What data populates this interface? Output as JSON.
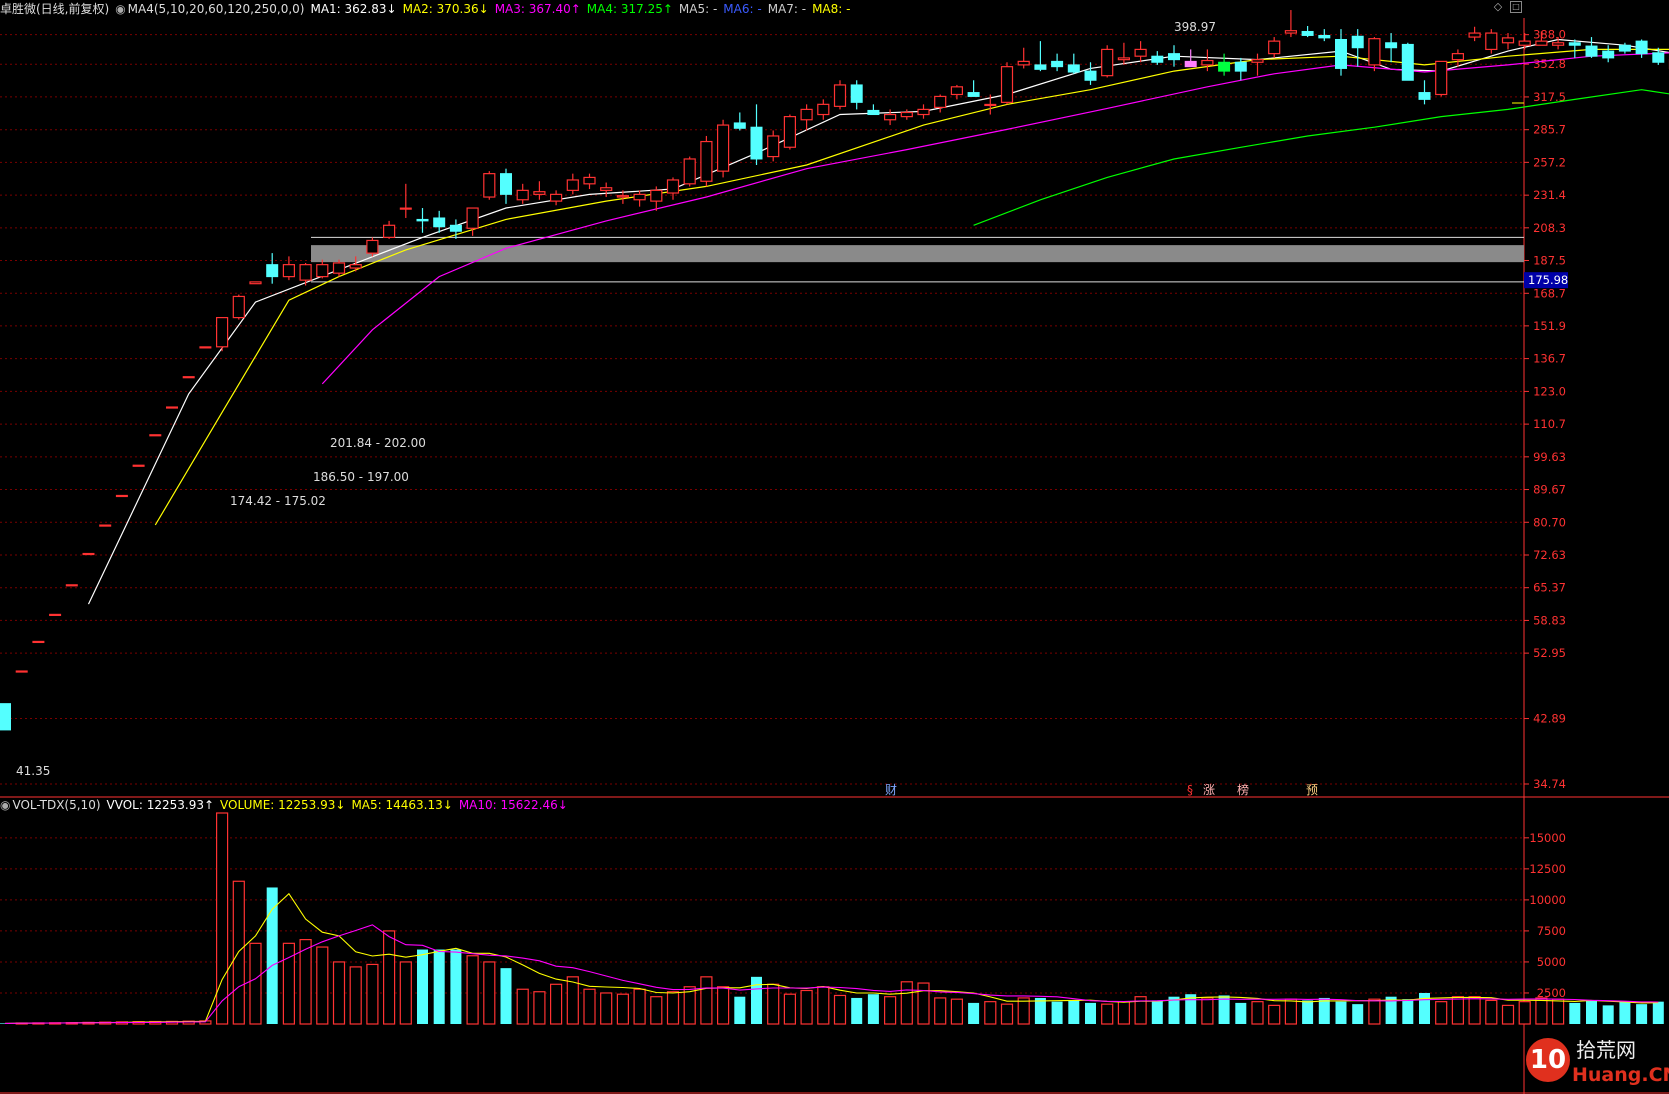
{
  "header": {
    "title": "卓胜微(日线,前复权)",
    "ma_params": "MA4(5,10,20,60,120,250,0,0)",
    "ma": [
      {
        "label": "MA1: 362.83↓",
        "color": "#ffffff"
      },
      {
        "label": "MA2: 370.36↓",
        "color": "#ffff00"
      },
      {
        "label": "MA3: 367.40↑",
        "color": "#ff00ff"
      },
      {
        "label": "MA4: 317.25↑",
        "color": "#00ff00"
      },
      {
        "label": "MA5: -",
        "color": "#cccccc"
      },
      {
        "label": "MA6: -",
        "color": "#3b5bff"
      },
      {
        "label": "MA7: -",
        "color": "#cccccc"
      },
      {
        "label": "MA8: -",
        "color": "#ffff00"
      }
    ]
  },
  "vol_header": {
    "name": "VOL-TDX(5,10)",
    "vvol": "VVOL: 12253.93↑",
    "volume": "VOLUME: 12253.93↓",
    "ma5": "MA5: 14463.13↓",
    "ma10": "MA10: 15622.46↓"
  },
  "annotations": {
    "high": "398.97",
    "low": "41.35",
    "range1": "201.84 - 202.00",
    "range2": "186.50 - 197.00",
    "range3": "174.42 - 175.02",
    "current_price": "175.98",
    "events": [
      "财",
      "§",
      "涨",
      "榜",
      "预"
    ]
  },
  "watermark": {
    "num": "10",
    "cn": "拾荒网",
    "en": "Huang.CN"
  },
  "colors": {
    "up": "#ff3232",
    "down": "#54ffff",
    "grid": "#7a0000",
    "axis": "#ff3232",
    "ma1": "#ffffff",
    "ma2": "#ffff00",
    "ma3": "#ff00ff",
    "ma4": "#00ff00"
  },
  "chart_data": [
    {
      "type": "candlestick",
      "title": "卓胜微(日线,前复权)",
      "y_ticks": [
        "388.0",
        "352.8",
        "317.5",
        "285.7",
        "257.2",
        "231.4",
        "208.3",
        "187.5",
        "168.7",
        "151.9",
        "136.7",
        "123.0",
        "110.7",
        "99.63",
        "89.67",
        "80.70",
        "72.63",
        "65.37",
        "58.83",
        "52.95",
        "42.89",
        "34.74"
      ],
      "y_scale": "log",
      "ylim": [
        34.74,
        398.97
      ],
      "candles": [
        [
          45,
          45,
          41.35,
          41.35
        ],
        [
          50,
          50,
          50,
          50
        ],
        [
          55,
          55,
          55,
          55
        ],
        [
          60,
          60,
          60,
          60
        ],
        [
          66,
          66,
          66,
          66
        ],
        [
          73,
          73,
          73,
          73
        ],
        [
          80,
          80,
          80,
          80
        ],
        [
          88,
          88,
          88,
          88
        ],
        [
          97,
          97,
          97,
          97
        ],
        [
          107,
          107,
          107,
          107
        ],
        [
          117,
          117,
          117,
          117
        ],
        [
          129,
          129,
          129,
          129
        ],
        [
          142,
          142,
          142,
          142
        ],
        [
          142,
          156,
          140,
          156
        ],
        [
          156,
          168,
          155,
          167
        ],
        [
          174,
          175.02,
          174.42,
          175
        ],
        [
          185,
          192,
          174,
          178
        ],
        [
          178,
          190,
          176,
          185
        ],
        [
          176,
          186,
          173,
          185
        ],
        [
          178,
          188,
          177,
          185
        ],
        [
          180,
          188,
          178,
          186
        ],
        [
          183,
          190,
          181,
          185
        ],
        [
          192,
          202,
          190,
          200
        ],
        [
          202,
          213,
          201,
          210
        ],
        [
          222,
          240,
          215,
          222
        ],
        [
          214,
          222,
          205,
          213
        ],
        [
          215,
          220,
          205,
          209
        ],
        [
          210,
          214,
          201,
          206
        ],
        [
          208,
          222,
          203,
          222
        ],
        [
          230,
          250,
          228,
          248
        ],
        [
          248,
          252,
          225,
          232
        ],
        [
          228,
          240,
          225,
          235
        ],
        [
          232,
          242,
          228,
          234
        ],
        [
          227,
          235,
          224,
          232
        ],
        [
          235,
          248,
          232,
          243
        ],
        [
          240,
          248,
          236,
          245
        ],
        [
          235,
          241,
          230,
          237
        ],
        [
          230,
          235,
          225,
          231
        ],
        [
          228,
          235,
          223,
          232
        ],
        [
          227,
          238,
          220,
          235
        ],
        [
          233,
          245,
          228,
          243
        ],
        [
          240,
          262,
          238,
          260
        ],
        [
          242,
          280,
          238,
          275
        ],
        [
          250,
          295,
          245,
          290
        ],
        [
          292,
          302,
          285,
          287
        ],
        [
          288,
          310,
          255,
          260
        ],
        [
          262,
          285,
          258,
          280
        ],
        [
          270,
          300,
          268,
          298
        ],
        [
          295,
          310,
          285,
          305
        ],
        [
          300,
          315,
          295,
          310
        ],
        [
          308,
          335,
          305,
          330
        ],
        [
          330,
          335,
          305,
          312
        ],
        [
          304,
          310,
          300,
          300
        ],
        [
          295,
          305,
          290,
          300
        ],
        [
          298,
          305,
          295,
          302
        ],
        [
          300,
          310,
          296,
          305
        ],
        [
          307,
          320,
          302,
          318
        ],
        [
          320,
          330,
          315,
          328
        ],
        [
          322,
          335,
          318,
          318
        ],
        [
          310,
          320,
          300,
          310
        ],
        [
          312,
          355,
          310,
          350
        ],
        [
          352,
          372,
          348,
          356
        ],
        [
          352,
          380,
          345,
          347
        ],
        [
          356,
          365,
          345,
          350
        ],
        [
          352,
          365,
          342,
          344
        ],
        [
          345,
          355,
          330,
          335
        ],
        [
          340,
          375,
          338,
          370
        ],
        [
          358,
          378,
          352,
          360
        ],
        [
          362,
          380,
          355,
          370
        ],
        [
          362,
          368,
          352,
          355
        ],
        [
          365,
          375,
          350,
          358
        ],
        [
          356,
          370,
          350,
          350
        ],
        [
          352,
          370,
          345,
          357
        ],
        [
          355,
          365,
          340,
          345
        ],
        [
          355,
          360,
          335,
          345
        ],
        [
          355,
          365,
          340,
          358
        ],
        [
          365,
          385,
          360,
          380
        ],
        [
          390,
          420,
          385,
          393
        ],
        [
          392,
          398.97,
          385,
          387
        ],
        [
          387,
          395,
          380,
          384
        ],
        [
          382,
          395,
          340,
          348
        ],
        [
          386,
          395,
          350,
          372
        ],
        [
          352,
          385,
          345,
          383
        ],
        [
          378,
          390,
          355,
          372
        ],
        [
          376,
          378,
          345,
          335
        ],
        [
          322,
          335,
          310,
          315
        ],
        [
          320,
          355,
          318,
          356
        ],
        [
          358,
          370,
          350,
          365
        ],
        [
          385,
          398,
          380,
          390
        ],
        [
          370,
          395,
          365,
          390
        ],
        [
          378,
          390,
          370,
          384
        ],
        [
          375,
          390,
          370,
          380
        ],
        [
          375,
          392,
          375,
          380
        ],
        [
          375,
          385,
          370,
          378
        ],
        [
          378,
          382,
          360,
          375
        ],
        [
          374,
          385,
          360,
          362
        ],
        [
          368,
          375,
          355,
          360
        ],
        [
          375,
          378,
          365,
          368
        ],
        [
          380,
          382,
          360,
          365
        ],
        [
          366,
          372,
          352,
          355
        ],
        [
          348,
          360,
          350,
          358
        ]
      ],
      "ma_lines": {
        "MA1": [
          [
            5,
            62
          ],
          [
            11,
            122
          ],
          [
            15,
            164
          ],
          [
            20,
            182
          ],
          [
            25,
            202
          ],
          [
            30,
            222
          ],
          [
            35,
            232
          ],
          [
            40,
            236
          ],
          [
            45,
            265
          ],
          [
            50,
            300
          ],
          [
            55,
            303
          ],
          [
            60,
            320
          ],
          [
            65,
            348
          ],
          [
            70,
            362
          ],
          [
            75,
            358
          ],
          [
            80,
            368
          ],
          [
            83,
            347
          ],
          [
            86,
            345
          ],
          [
            90,
            368
          ],
          [
            93,
            382
          ],
          [
            97,
            375
          ],
          [
            101,
            362
          ]
        ],
        "MA2": [
          [
            9,
            80
          ],
          [
            13,
            115
          ],
          [
            17,
            165
          ],
          [
            20,
            178
          ],
          [
            24,
            194
          ],
          [
            30,
            214
          ],
          [
            36,
            227
          ],
          [
            42,
            238
          ],
          [
            48,
            255
          ],
          [
            55,
            290
          ],
          [
            60,
            310
          ],
          [
            65,
            325
          ],
          [
            70,
            345
          ],
          [
            75,
            358
          ],
          [
            80,
            362
          ],
          [
            85,
            352
          ],
          [
            90,
            362
          ],
          [
            95,
            370
          ],
          [
            101,
            370
          ]
        ],
        "MA3": [
          [
            19,
            126
          ],
          [
            22,
            150
          ],
          [
            26,
            178
          ],
          [
            30,
            195
          ],
          [
            36,
            213
          ],
          [
            42,
            230
          ],
          [
            48,
            252
          ],
          [
            54,
            268
          ],
          [
            60,
            286
          ],
          [
            66,
            306
          ],
          [
            72,
            328
          ],
          [
            76,
            342
          ],
          [
            80,
            352
          ],
          [
            85,
            344
          ],
          [
            90,
            352
          ],
          [
            95,
            362
          ],
          [
            101,
            367
          ]
        ],
        "MA4": [
          [
            58,
            210
          ],
          [
            62,
            228
          ],
          [
            66,
            245
          ],
          [
            70,
            260
          ],
          [
            74,
            270
          ],
          [
            78,
            280
          ],
          [
            82,
            288
          ],
          [
            86,
            298
          ],
          [
            90,
            305
          ],
          [
            94,
            315
          ],
          [
            98,
            325
          ],
          [
            101,
            317.25
          ]
        ]
      }
    },
    {
      "type": "bar",
      "title": "VOL-TDX(5,10)",
      "y_ticks": [
        "15000",
        "12500",
        "10000",
        "7500",
        "5000",
        "2500"
      ],
      "ylim": [
        0,
        17000
      ],
      "volumes": [
        50,
        80,
        90,
        100,
        110,
        130,
        150,
        170,
        190,
        200,
        210,
        230,
        250,
        17000,
        11500,
        6500,
        11000,
        6500,
        6800,
        6200,
        5000,
        4600,
        4800,
        7500,
        5000,
        6000,
        6000,
        6000,
        5500,
        5000,
        4500,
        2800,
        2600,
        3200,
        3800,
        2800,
        2500,
        2400,
        2800,
        2200,
        2600,
        3000,
        3800,
        3000,
        2200,
        3800,
        3200,
        2400,
        2700,
        3000,
        2300,
        2100,
        2400,
        2200,
        3400,
        3300,
        2100,
        2000,
        1700,
        1800,
        1600,
        2100,
        2100,
        1800,
        1900,
        1700,
        1600,
        1800,
        2200,
        1900,
        2200,
        2400,
        2100,
        2300,
        1700,
        1800,
        1500,
        2000,
        1900,
        2100,
        1800,
        1600,
        2000,
        2200,
        2000,
        2500,
        1800,
        2200,
        2200,
        1900,
        1500,
        1800,
        2100,
        2000,
        1700,
        1900,
        1500,
        1800,
        1600,
        1800
      ]
    }
  ]
}
